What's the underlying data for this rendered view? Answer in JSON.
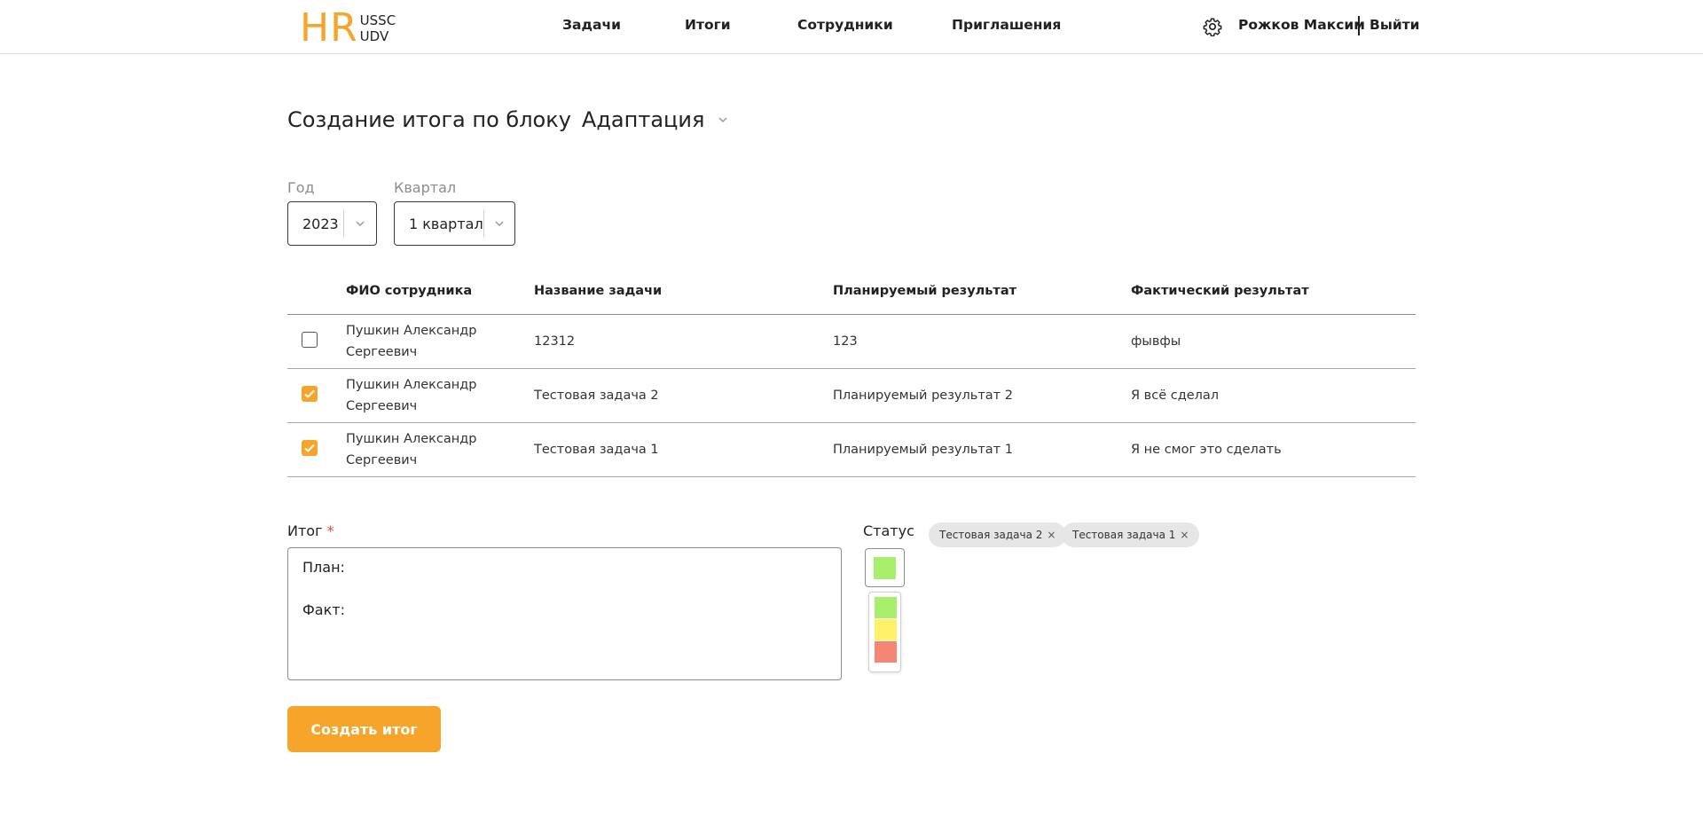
{
  "header": {
    "logo_main": "HR",
    "logo_top": "USSC",
    "logo_bottom": "UDV",
    "nav": [
      "Задачи",
      "Итоги",
      "Сотрудники",
      "Приглашения"
    ],
    "user_name": "Рожков Максим",
    "logout_label": "Выйти"
  },
  "page": {
    "title": "Создание итога по блоку",
    "block_value": "Адаптация"
  },
  "filters": {
    "year_label": "Год",
    "year_value": "2023",
    "quarter_label": "Квартал",
    "quarter_value": "1 квартал"
  },
  "table": {
    "headers": [
      "ФИО сотрудника",
      "Название задачи",
      "Планируемый результат",
      "Фактический результат"
    ],
    "rows": [
      {
        "checked": false,
        "employee": "Пушкин Александр Сергеевич",
        "task": "12312",
        "planned": "123",
        "actual": "фывфы"
      },
      {
        "checked": true,
        "employee": "Пушкин Александр Сергеевич",
        "task": "Тестовая задача 2",
        "planned": "Планируемый результат 2",
        "actual": "Я всё сделал"
      },
      {
        "checked": true,
        "employee": "Пушкин Александр Сергеевич",
        "task": "Тестовая задача 1",
        "planned": "Планируемый результат 1",
        "actual": "Я не смог это сделать"
      }
    ]
  },
  "result": {
    "label": "Итог",
    "required_mark": "*",
    "text": "План:\n\nФакт:",
    "status_label": "Статус",
    "status_selected_color": "#a8f06c",
    "status_options": [
      "#a8f06c",
      "#fdf26a",
      "#f58674"
    ],
    "tags": [
      "Тестовая задача 2",
      "Тестовая задача 1"
    ],
    "tag_remove": "×",
    "submit_label": "Создать итог"
  },
  "colors": {
    "accent": "#f7a42a"
  }
}
